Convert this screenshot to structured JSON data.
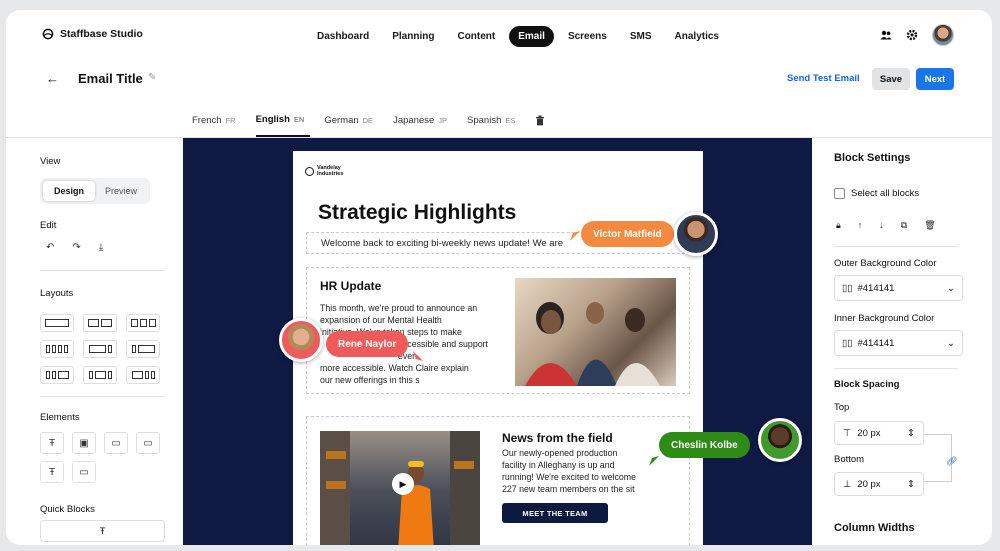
{
  "app": {
    "name": "Staffbase Studio"
  },
  "nav": {
    "tabs": [
      "Dashboard",
      "Planning",
      "Content",
      "Email",
      "Screens",
      "SMS",
      "Analytics"
    ],
    "active": "Email"
  },
  "header": {
    "title": "Email Title",
    "send_test": "Send Test Email",
    "save": "Save",
    "next": "Next"
  },
  "languages": [
    {
      "name": "French",
      "code": "FR"
    },
    {
      "name": "English",
      "code": "EN",
      "active": true
    },
    {
      "name": "German",
      "code": "DE"
    },
    {
      "name": "Japanese",
      "code": "JP"
    },
    {
      "name": "Spanish",
      "code": "ES"
    }
  ],
  "left_panel": {
    "view_label": "View",
    "view_design": "Design",
    "view_preview": "Preview",
    "edit_label": "Edit",
    "layouts_label": "Layouts",
    "elements_label": "Elements",
    "quick_blocks_label": "Quick Blocks"
  },
  "email": {
    "brand": "Vandelay Industries",
    "brand_line1": "Vandelay",
    "brand_line2": "Industries",
    "heading": "Strategic Highlights",
    "welcome": "Welcome back to exciting bi-weekly news update! We are",
    "hr_title": "HR Update",
    "hr_text_1": "This month, we're proud to announce an",
    "hr_text_2": "expansion of our Mental Health",
    "hr_text_3": "initiative. We've taken steps to make",
    "hr_text_4": "accessible and support even",
    "hr_text_5": "more accessible. Watch Claire explain",
    "hr_text_6": "our new offerings in this s",
    "news_title": "News from the field",
    "news_text_1": "Our newly-opened production",
    "news_text_2": "facility in Alleghany is up and",
    "news_text_3": "running! We're excited to welcome",
    "news_text_4": "227 new team members on the sit",
    "cta": "MEET THE TEAM"
  },
  "collaborators": [
    {
      "name": "Victor Matfield",
      "color": "#f5893f"
    },
    {
      "name": "Rene Naylor",
      "color": "#ef5a5a"
    },
    {
      "name": "Cheslin Kolbe",
      "color": "#2e8b16"
    }
  ],
  "right_panel": {
    "title": "Block Settings",
    "select_all": "Select all blocks",
    "outer_bg_label": "Outer Background Color",
    "outer_bg_value": "#414141",
    "inner_bg_label": "Inner Background Color",
    "inner_bg_value": "#414141",
    "spacing_label": "Block Spacing",
    "top_label": "Top",
    "top_value": "20 px",
    "bottom_label": "Bottom",
    "bottom_value": "20 px",
    "column_widths_label": "Column Widths"
  },
  "colors": {
    "accent": "#1876e8",
    "canvas": "#0f1a44",
    "primary_dark": "#111111"
  }
}
